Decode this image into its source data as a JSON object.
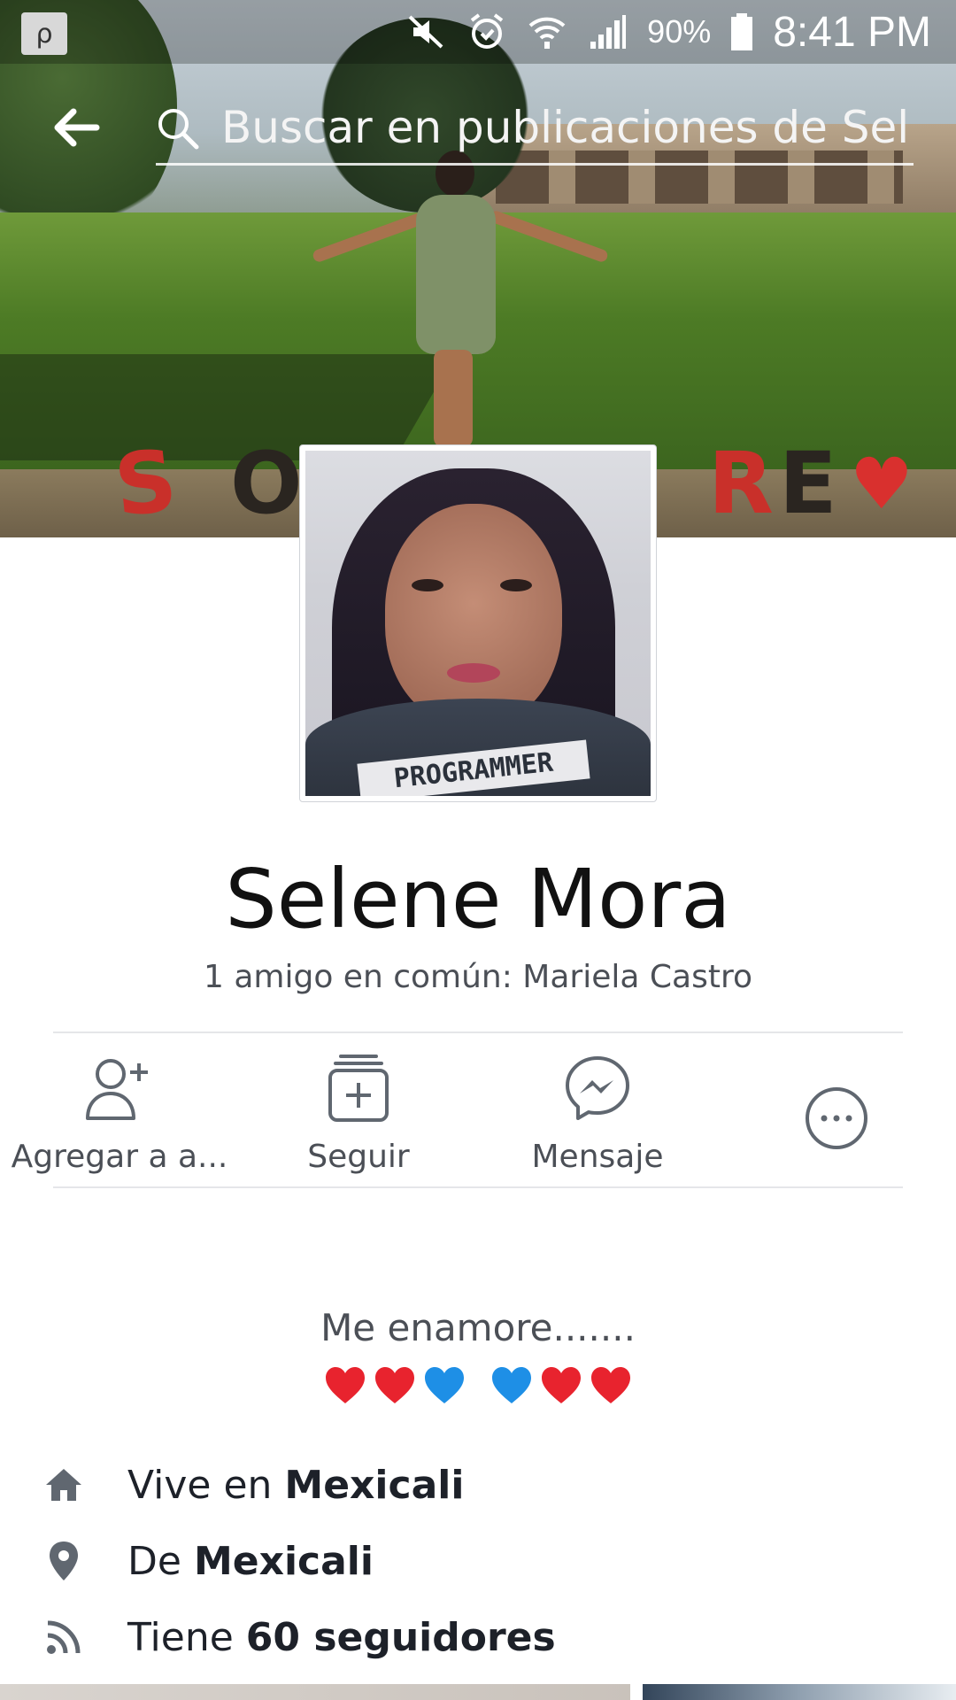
{
  "status_bar": {
    "battery": "90%",
    "time": "8:41 PM",
    "icons": [
      "app-notification-icon",
      "mute-icon",
      "alarm-icon",
      "wifi-icon",
      "signal-icon",
      "battery-icon"
    ]
  },
  "search": {
    "placeholder": "Buscar en publicaciones de Sel..."
  },
  "profile": {
    "name": "Selene Mora",
    "mutual_friends": "1 amigo en común: Mariela Castro",
    "cover_letters": [
      "S",
      "O",
      "R",
      "E",
      "♥"
    ],
    "hoodie_print": "PROGRAMMER"
  },
  "actions": [
    {
      "label": "Agregar a a...",
      "icon": "add-friend-icon"
    },
    {
      "label": "Seguir",
      "icon": "follow-icon"
    },
    {
      "label": "Mensaje",
      "icon": "messenger-icon"
    },
    {
      "label": "",
      "icon": "more-icon"
    }
  ],
  "bio": {
    "text": "Me enamore.......",
    "hearts": [
      "red",
      "red",
      "blue",
      "blue",
      "red",
      "red"
    ]
  },
  "info": [
    {
      "icon": "home-icon",
      "prefix": "Vive en ",
      "value": "Mexicali"
    },
    {
      "icon": "location-pin-icon",
      "prefix": "De ",
      "value": "Mexicali"
    },
    {
      "icon": "rss-followers-icon",
      "prefix": "Tiene ",
      "value": "60 seguidores"
    }
  ],
  "colors": {
    "text_primary": "#1d2129",
    "text_secondary": "#4b4f56",
    "icon_gray": "#606770",
    "heart_red": "#e8232e",
    "heart_blue": "#1e8fe6"
  }
}
